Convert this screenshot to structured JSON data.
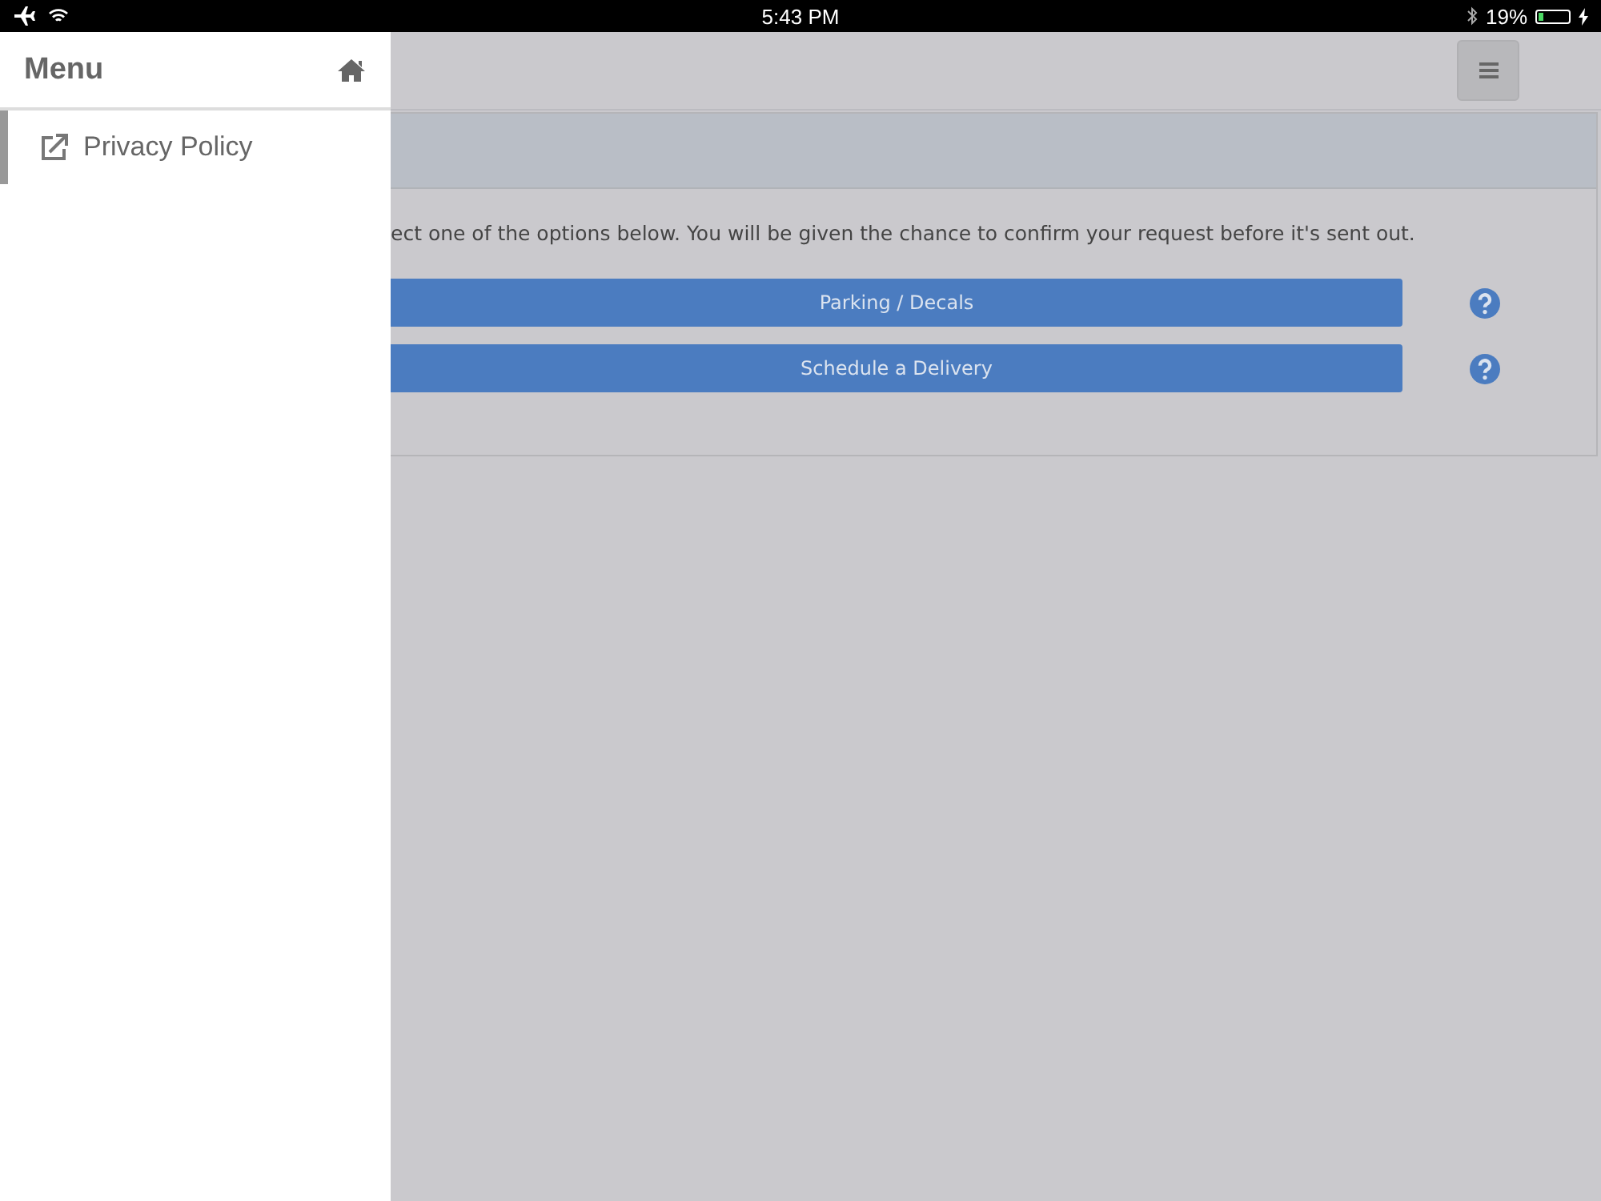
{
  "status_bar": {
    "time": "5:43 PM",
    "battery_text": "19%",
    "battery": {
      "level": 0.19
    }
  },
  "drawer": {
    "title": "Menu",
    "items": [
      {
        "label": "Privacy Policy",
        "selected": true
      }
    ]
  },
  "panel": {
    "intro": "ect one of the options below. You will be given the chance to confirm your request before it's sent out.",
    "options": [
      {
        "label": "Parking / Decals"
      },
      {
        "label": "Schedule a Delivery"
      }
    ]
  }
}
